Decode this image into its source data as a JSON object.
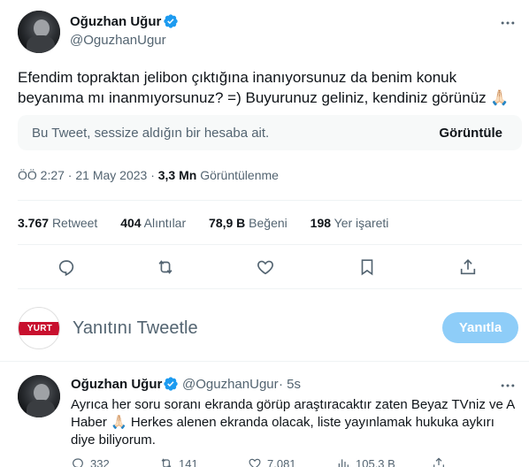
{
  "tweet": {
    "author_name": "Oğuzhan Uğur",
    "author_handle": "@OguzhanUgur",
    "text": "Efendim topraktan jelibon çıktığına inanıyorsunuz da benim konuk beyanıma mı inanmıyorsunuz? =) Buyurunuz geliniz, kendiniz görünüz 🙏🏻",
    "muted_notice": "Bu Tweet, sessize aldığın bir hesaba ait.",
    "show_label": "Görüntüle",
    "time": "ÖÖ 2:27 · 21 May 2023 · ",
    "views_value": "3,3 Mn",
    "views_label": " Görüntülenme",
    "stats": {
      "retweets_value": "3.767",
      "retweets_label": "Retweet",
      "quotes_value": "404",
      "quotes_label": "Alıntılar",
      "likes_value": "78,9 B",
      "likes_label": "Beğeni",
      "bookmarks_value": "198",
      "bookmarks_label": "Yer işareti"
    }
  },
  "composer": {
    "avatar_text": "YURT",
    "placeholder": "Yanıtını Tweetle",
    "button_label": "Yanıtla"
  },
  "reply": {
    "author_name": "Oğuzhan Uğur",
    "author_handle": "@OguzhanUgur",
    "time": "· 5s",
    "text": "Ayrıca her soru soranı ekranda görüp araştıracaktır zaten Beyaz TVniz ve A Haber 🙏🏻 Herkes alenen ekranda olacak, liste yayınlamak hukuka aykırı diye biliyorum.",
    "actions": {
      "replies": "332",
      "retweets": "141",
      "likes": "7.081",
      "views": "105,3 B"
    }
  },
  "colors": {
    "verified": "#1d9bf0",
    "muted_text": "#536471",
    "reply_button": "#8ecdf8",
    "divider": "#eff3f4",
    "yurt_red": "#c8102e"
  }
}
